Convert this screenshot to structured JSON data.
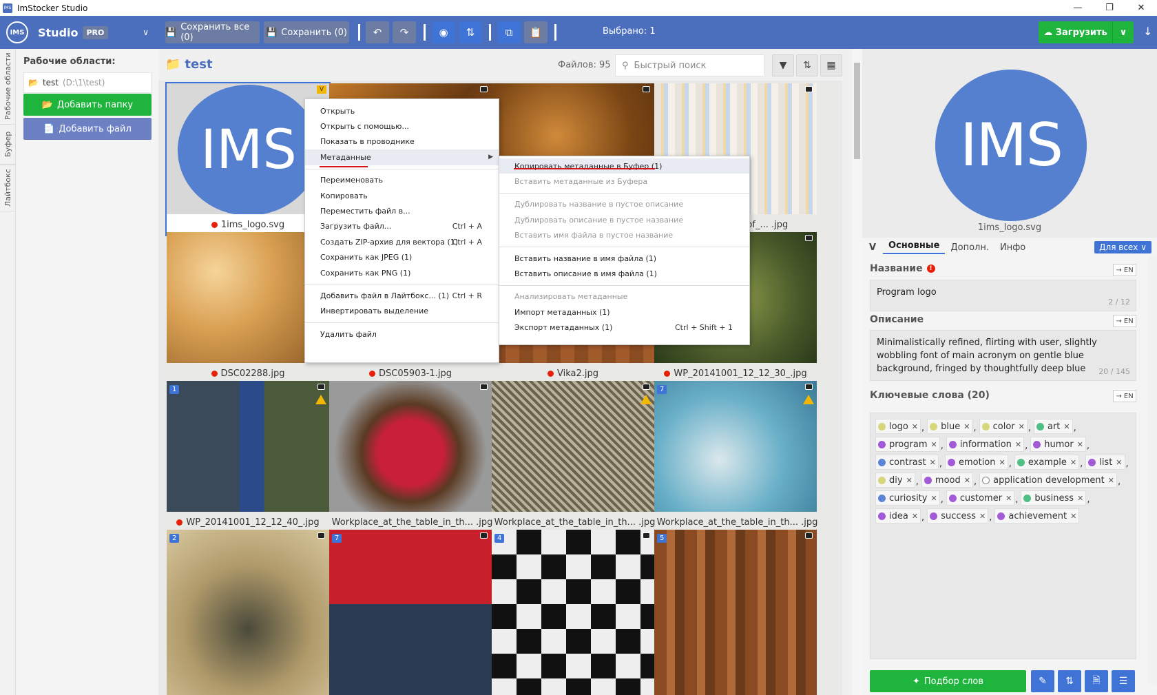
{
  "window": {
    "title": "ImStocker Studio"
  },
  "brand": {
    "logo": "IMS",
    "name": "Studio",
    "edition": "PRO"
  },
  "toolbar": {
    "save_all": "Сохранить все (0)",
    "save": "Сохранить (0)",
    "selected": "Выбрано: 1",
    "upload": "Загрузить"
  },
  "sidebar_tabs": [
    "Рабочие области",
    "Буфер",
    "Лайтбокс"
  ],
  "left": {
    "header": "Рабочие области:",
    "workspace_name": "test",
    "workspace_path": "(D:\\1\\test)",
    "add_folder": "Добавить папку",
    "add_file": "Добавить файл"
  },
  "main": {
    "folder": "test",
    "file_count": "Файлов: 95",
    "search_placeholder": "Быстрый поиск"
  },
  "tiles": [
    {
      "name": "1ims_logo.svg"
    },
    {
      "name": ""
    },
    {
      "name": ""
    },
    {
      "name": "_consisting_of_... .jpg"
    },
    {
      "name": "DSC02288.jpg"
    },
    {
      "name": "DSC05903-1.jpg"
    },
    {
      "name": "Vika2.jpg"
    },
    {
      "name": "WP_20141001_12_12_30_.jpg"
    },
    {
      "name": "WP_20141001_12_12_40_.jpg",
      "badge": "1"
    },
    {
      "name": "Workplace_at_the_table_in_th... .jpg"
    },
    {
      "name": "Workplace_at_the_table_in_th... .jpg"
    },
    {
      "name": "Workplace_at_the_table_in_th... .jpg",
      "badge": "7"
    },
    {
      "name": "",
      "badge": "2"
    },
    {
      "name": "",
      "badge": "7"
    },
    {
      "name": "",
      "badge": "4"
    },
    {
      "name": "",
      "badge": "5"
    }
  ],
  "context_menu": {
    "items": [
      "Открыть",
      "Открыть с помощью...",
      "Показать в проводнике",
      "Метаданные",
      "Переименовать",
      "Копировать",
      "Переместить файл в...",
      "Загрузить файл...",
      "Создать ZIP-архив для вектора (1)",
      "Сохранить как JPEG (1)",
      "Сохранить как PNG (1)",
      "Добавить файл в Лайтбокс... (1)",
      "Инвертировать выделение",
      "Удалить файл"
    ],
    "shortcuts": {
      "upload": "Ctrl + A",
      "zip": "Ctrl + A",
      "lightbox": "Ctrl + R"
    }
  },
  "submenu": {
    "items": [
      "Копировать метаданные в Буфер (1)",
      "Вставить метаданные из Буфера",
      "Дублировать название в пустое описание",
      "Дублировать описание в пустое название",
      "Вставить имя файла в пустое название",
      "Вставить название в имя файла (1)",
      "Вставить описание в имя файла (1)",
      "Анализировать метаданные",
      "Импорт метаданных (1)",
      "Экспорт метаданных (1)"
    ],
    "export_shortcut": "Ctrl + Shift + 1"
  },
  "right": {
    "preview_text": "IMS",
    "filename": "1ims_logo.svg",
    "tabs": [
      "Основные",
      "Дополн.",
      "Инфо"
    ],
    "for_all": "Для всех",
    "title_label": "Название",
    "title_value": "Program logo",
    "title_count": "2 / 12",
    "desc_label": "Описание",
    "desc_value": "Minimalistically refined, flirting with user, slightly wobbling font of main acronym on gentle blue background, fringed by thoughtfully deep blue",
    "desc_count": "20 / 145",
    "kw_label": "Ключевые слова (20)",
    "en": "EN",
    "pick_words": "Подбор слов"
  },
  "keywords": [
    {
      "w": "logo",
      "c": "#d6d67a"
    },
    {
      "w": "blue",
      "c": "#d6d67a"
    },
    {
      "w": "color",
      "c": "#d6d67a"
    },
    {
      "w": "art",
      "c": "#4fbf86"
    },
    {
      "w": "program",
      "c": "#a25ad6"
    },
    {
      "w": "information",
      "c": "#a25ad6"
    },
    {
      "w": "humor",
      "c": "#a25ad6"
    },
    {
      "w": "contrast",
      "c": "#5b86d6"
    },
    {
      "w": "emotion",
      "c": "#a25ad6"
    },
    {
      "w": "example",
      "c": "#4fbf86"
    },
    {
      "w": "list",
      "c": "#a25ad6"
    },
    {
      "w": "diy",
      "c": "#d6d67a"
    },
    {
      "w": "mood",
      "c": "#a25ad6"
    },
    {
      "w": "application development",
      "c": "#ffffff"
    },
    {
      "w": "curiosity",
      "c": "#5b86d6"
    },
    {
      "w": "customer",
      "c": "#a25ad6"
    },
    {
      "w": "business",
      "c": "#4fbf86"
    },
    {
      "w": "idea",
      "c": "#a25ad6"
    },
    {
      "w": "success",
      "c": "#a25ad6"
    },
    {
      "w": "achievement",
      "c": "#a25ad6"
    }
  ],
  "colors": {
    "brand": "#4b6fbd",
    "accent": "#3f73d6",
    "green": "#1fb53d",
    "error": "#e8200a"
  }
}
